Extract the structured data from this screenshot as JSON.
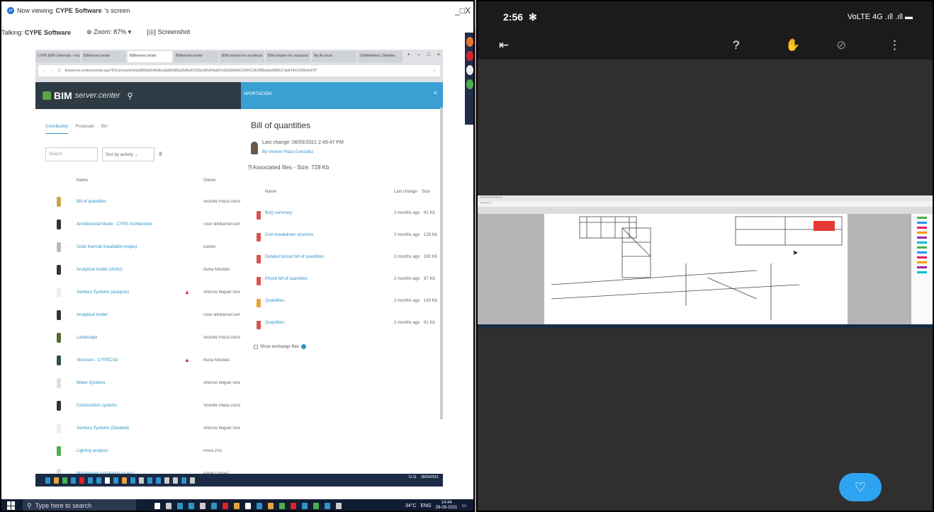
{
  "teamviewer": {
    "viewing_prefix": "Now viewing",
    "viewing_name": "CYPE Software",
    "viewing_suffix": "'s screen",
    "talking_label": "Talking:",
    "talking_name": "CYPE Software",
    "zoom_label": "Zoom: 87%",
    "screenshot_label": "Screenshot"
  },
  "browser": {
    "tabs": [
      "CYPE BIM University - Incl...",
      "BIMserver.center",
      "BIMserver.center",
      "BIMserver.center",
      "BIM solution for architects",
      "BIM solution for structural",
      "My Account",
      "OutlWebinar | Detalles"
    ],
    "url": "bimserver.center/remote.asp?IDcommand=e0a0809dc54f6d5ca6d35fd5fa3b0fcd0225bc0f6304ad07e502d6fd04215f4110fc0f90adeaf9f0517ab4742101f9efe37f7"
  },
  "bim": {
    "brand": "BIM",
    "brand_sub": "server.center",
    "filter_tabs": [
      "Contribution",
      "Proposals",
      "Bin"
    ],
    "search_placeholder": "Search",
    "sort_label": "Sort by activity",
    "col_name": "Name",
    "col_owner": "Owner",
    "rows": [
      {
        "name": "Bill of quantities",
        "owner": "Vicente Plaza Gonzalez",
        "warn": false,
        "color": "#c6a44a"
      },
      {
        "name": "Architectural Model - CYPE Architecture",
        "owner": "User BIMserver.center",
        "warn": false,
        "color": "#333333"
      },
      {
        "name": "Solar thermal installation project",
        "owner": "Daniel",
        "warn": false,
        "color": "#bbbbbb"
      },
      {
        "name": "Analytical model (Victor)",
        "owner": "Nuria Morales",
        "warn": false,
        "color": "#333333"
      },
      {
        "name": "Sanitary Systems (analysis)",
        "owner": "Alfonso Miguel Solak",
        "warn": true,
        "color": "#eeeeee"
      },
      {
        "name": "Analytical model",
        "owner": "User BIMserver.center",
        "warn": false,
        "color": "#333333"
      },
      {
        "name": "Landscape",
        "owner": "Vicente Plaza Gonzalez",
        "warn": false,
        "color": "#556b2f"
      },
      {
        "name": "Structure - CYPECAD",
        "owner": "Nuria Morales",
        "warn": true,
        "color": "#2f4f4f"
      },
      {
        "name": "Water Systems",
        "owner": "Alfonso Miguel Solak",
        "warn": false,
        "color": "#dddddd"
      },
      {
        "name": "Construction systems",
        "owner": "Vicente Plaza Gonzalez",
        "warn": false,
        "color": "#333333"
      },
      {
        "name": "Sanitary Systems (Detailed)",
        "owner": "Alfonso Miguel Solak",
        "warn": false,
        "color": "#eeeeee"
      },
      {
        "name": "Lighting analysis",
        "owner": "Rosa Zhu",
        "warn": false,
        "color": "#4caf50"
      },
      {
        "name": "Wastewater installation project",
        "owner": "Pablo Gómez",
        "warn": false,
        "color": "#dddddd"
      }
    ]
  },
  "aportacion": {
    "header": "APORTACIÓN",
    "close": "×",
    "title": "Bill of quantities",
    "last_change": "Last change: 08/05/2021 2:49:47 PM",
    "by": "By Vicente Plaza Gonzalez",
    "associated": "Associated files - Size: 728 Kb",
    "col_name": "Name",
    "col_last": "Last change",
    "col_size": "Size",
    "files": [
      {
        "name": "BoQ summary",
        "last": "2 months ago",
        "size": "81 Kb",
        "color": "#d9534f"
      },
      {
        "name": "Cost breakdown structure",
        "last": "2 months ago",
        "size": "128 Kb",
        "color": "#d9534f"
      },
      {
        "name": "Detailed priced bill of quantities",
        "last": "2 months ago",
        "size": "180 Kb",
        "color": "#d9534f"
      },
      {
        "name": "Priced bill of quantities",
        "last": "2 months ago",
        "size": "87 Kb",
        "color": "#d9534f"
      },
      {
        "name": "Quantities",
        "last": "2 months ago",
        "size": "143 Kb",
        "color": "#e8a33c"
      },
      {
        "name": "Quantities",
        "last": "2 months ago",
        "size": "91 Kb",
        "color": "#d9534f"
      }
    ],
    "show_exchange": "Show exchange files"
  },
  "remote_taskbar": {
    "clock_time": "11:11",
    "clock_date": "28/09/2021",
    "icon_colors": [
      "#2e94c8",
      "#e8a33c",
      "#4caf50",
      "#2e94c8",
      "#d9242b",
      "#2e94c8",
      "#2e94c8",
      "#ffffff",
      "#2e94c8",
      "#e8a33c",
      "#2e94c8",
      "#cccccc",
      "#2e94c8",
      "#2e94c8",
      "#cccccc",
      "#cccccc",
      "#2e94c8",
      "#cccccc"
    ]
  },
  "local_taskbar": {
    "search_placeholder": "Type here to search",
    "temp": "34°C",
    "lang": "ENG",
    "time": "14:44",
    "date": "28-09-2021",
    "icon_colors": [
      "#ffffff",
      "#cccccc",
      "#2e94c8",
      "#2e94c8",
      "#cccccc",
      "#2e94c8",
      "#d9242b",
      "#e8a33c",
      "#ffffff",
      "#2e94c8",
      "#e8a33c",
      "#4caf50",
      "#d9242b",
      "#2e94c8",
      "#4caf50",
      "#2e94c8",
      "#cccccc"
    ]
  },
  "phone": {
    "time": "2:56",
    "status_icons": "VoLTE 4G .ıll .ıll ▬",
    "help": "?"
  }
}
